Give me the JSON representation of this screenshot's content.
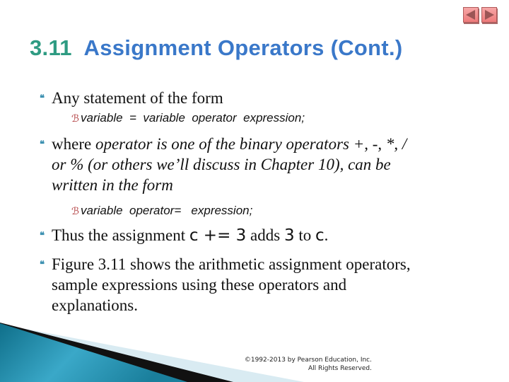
{
  "nav": {
    "prev_icon": "triangle-left-icon",
    "next_icon": "triangle-right-icon"
  },
  "title": {
    "number": "3.11",
    "text": "Assignment Operators (Cont.)"
  },
  "bullets": [
    {
      "text": "Any statement of the form"
    },
    {
      "lead": "where ",
      "italic": "operator is one of the binary operators ",
      "ops": "+, -, *, /",
      "line2": "or % (or others we’ll discuss in Chapter 10), can be",
      "line3": "written in the form"
    },
    {
      "pre": "Thus the assignment ",
      "code1": "c += 3",
      "mid": " adds ",
      "code2": "3",
      "mid2": " to ",
      "code3": "c",
      "end": "."
    },
    {
      "line1": "Figure 3.11 shows the arithmetic assignment operators,",
      "line2": "sample expressions using these operators and",
      "line3": "explanations."
    }
  ],
  "subbullets": [
    {
      "text": "variable  =  variable  operator  expression;"
    },
    {
      "text": "variable  operator=   expression;"
    }
  ],
  "footer": {
    "copyright_line1": "©1992-2013 by Pearson Education, Inc.",
    "copyright_line2": "All Rights Reserved."
  },
  "colors": {
    "title_number": "#2e9b82",
    "title_text": "#3a78c9",
    "bullet": "#3a8fb0",
    "subbullet": "#b0393b",
    "nav_button": "#ee7b7b"
  }
}
